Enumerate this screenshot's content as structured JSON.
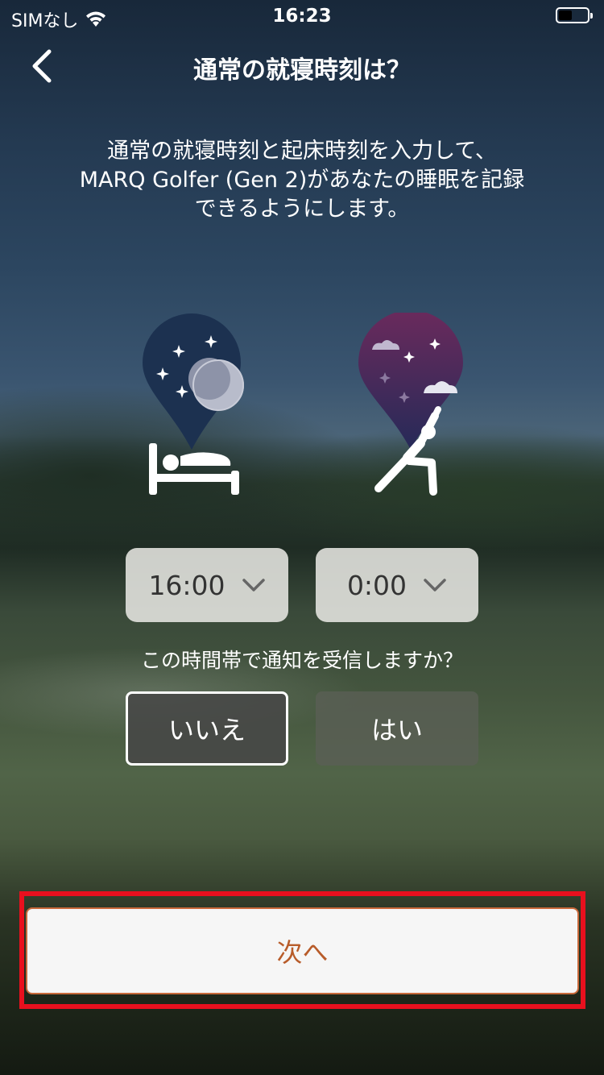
{
  "status_bar": {
    "carrier": "SIMなし",
    "time": "16:23",
    "wifi_icon": "wifi-icon",
    "battery_icon": "battery-icon"
  },
  "header": {
    "back_icon": "chevron-left-icon",
    "title": "通常の就寝時刻は？"
  },
  "description": {
    "line1": "通常の就寝時刻と起床時刻を入力して、",
    "line2": "MARQ Golfer (Gen 2)があなたの睡眠を記録",
    "line3": "できるようにします。"
  },
  "icons": {
    "bedtime": "bed-moon-icon",
    "wake": "stretch-sunrise-icon"
  },
  "times": {
    "bedtime": "16:00",
    "wake": "0:00",
    "dropdown_icon": "chevron-down-icon"
  },
  "notification": {
    "question": "この時間帯で通知を受信しますか？",
    "no_label": "いいえ",
    "yes_label": "はい",
    "selected": "いいえ"
  },
  "footer": {
    "next_label": "次へ"
  },
  "colors": {
    "accent": "#b85c2a",
    "highlight": "#e8101e"
  }
}
